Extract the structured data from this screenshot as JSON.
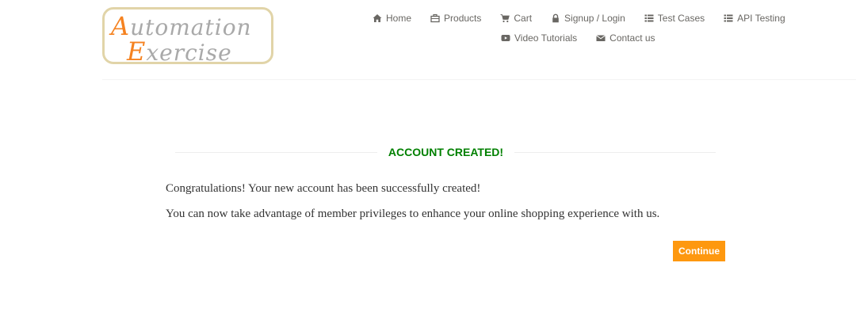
{
  "logo": {
    "line1_cap": "A",
    "line1_rest": "utomation",
    "line2_cap": "E",
    "line2_rest": "xercise"
  },
  "nav": {
    "row1": [
      {
        "label": "Home",
        "icon": "home-icon"
      },
      {
        "label": "Products",
        "icon": "products-icon"
      },
      {
        "label": "Cart",
        "icon": "cart-icon"
      },
      {
        "label": "Signup / Login",
        "icon": "lock-icon"
      },
      {
        "label": "Test Cases",
        "icon": "list-icon"
      },
      {
        "label": "API Testing",
        "icon": "list-icon"
      }
    ],
    "row2": [
      {
        "label": "Video Tutorials",
        "icon": "youtube-play-icon"
      },
      {
        "label": "Contact us",
        "icon": "envelope-icon"
      }
    ]
  },
  "main": {
    "title": "ACCOUNT CREATED!",
    "paragraph1": "Congratulations! Your new account has been successfully created!",
    "paragraph2": "You can now take advantage of member privileges to enhance your online shopping experience with us.",
    "continue_label": "Continue"
  },
  "colors": {
    "accent": "#fe980f",
    "success_title": "#008000",
    "logo_orange": "#f58220",
    "logo_border": "#e1d4a8",
    "nav_text": "#696763"
  }
}
